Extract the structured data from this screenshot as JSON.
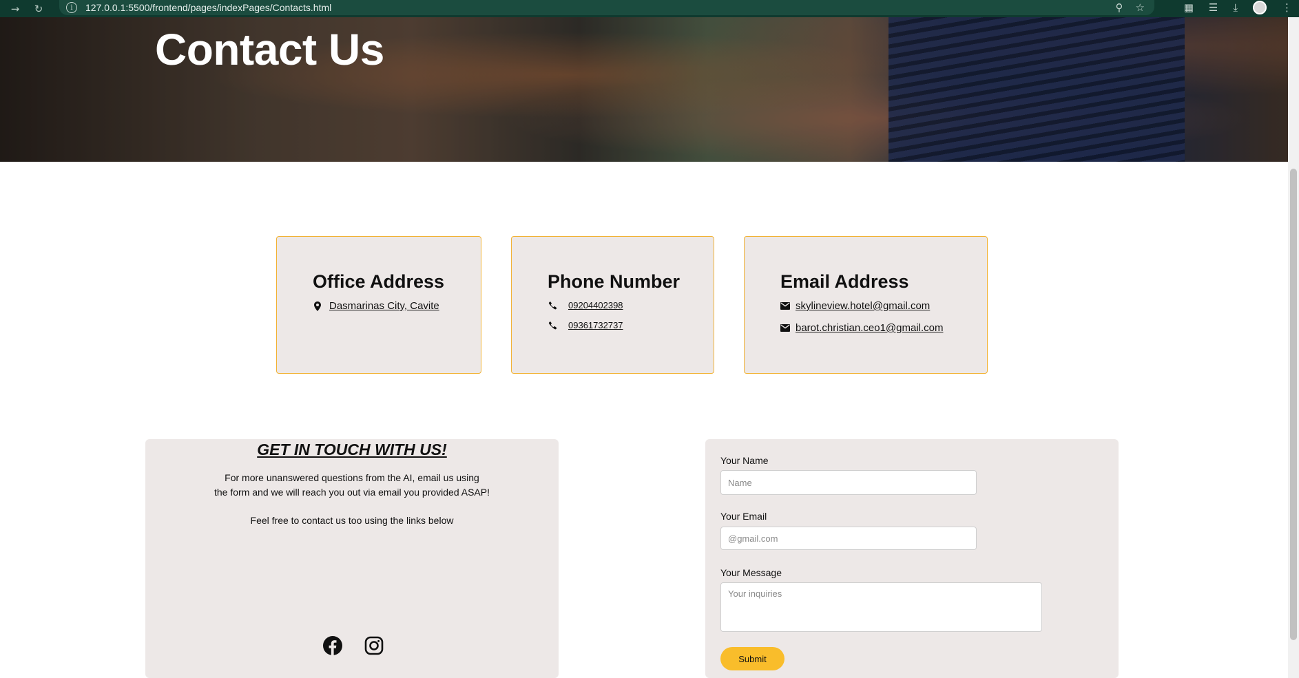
{
  "browser": {
    "url": "127.0.0.1:5500/frontend/pages/indexPages/Contacts.html",
    "back_icon": "arrow-right-icon",
    "reload_icon": "reload-icon"
  },
  "hero": {
    "title": "Contact Us"
  },
  "cards": {
    "office": {
      "title": "Office Address",
      "address": "Dasmarinas City, Cavite"
    },
    "phone": {
      "title": "Phone Number",
      "numbers": [
        "09204402398",
        "09361732737"
      ]
    },
    "email": {
      "title": "Email Address",
      "addresses": [
        "skylineview.hotel@gmail.com",
        "barot.christian.ceo1@gmail.com"
      ]
    }
  },
  "touch": {
    "title": "GET IN TOUCH WITH US!",
    "line1": "For more unanswered questions from the AI, email us using",
    "line2": "the form and we will reach you out via email you provided ASAP!",
    "line3": "Feel free to contact us too using the links below"
  },
  "form": {
    "name_label": "Your Name",
    "name_placeholder": "Name",
    "email_label": "Your Email",
    "email_placeholder": "@gmail.com",
    "message_label": "Your Message",
    "message_placeholder": "Your inquiries",
    "submit_label": "Submit"
  },
  "colors": {
    "accent": "#f9bd2b",
    "card_border": "#f2b233",
    "panel_bg": "#ede8e7",
    "browser_bar": "#0f3a2f"
  }
}
